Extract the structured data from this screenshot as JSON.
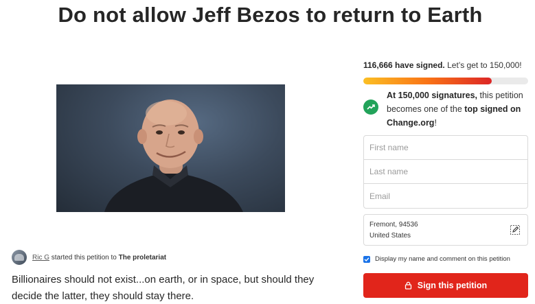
{
  "petition": {
    "title": "Do not allow Jeff Bezos to return to Earth",
    "starter_name": "Ric G",
    "starter_mid": "started this petition to",
    "target": "The proletariat",
    "description": "Billionaires should not exist...on earth, or in space, but should they decide the latter, they should stay there."
  },
  "sidebar": {
    "signed_count": "116,666 have signed.",
    "signed_goal": "Let’s get to 150,000!",
    "progress": 0.78,
    "goal_strong1": "At 150,000 signatures,",
    "goal_mid": "this petition becomes one of the",
    "goal_strong2": "top signed on Change.org",
    "goal_end": "!",
    "first_name_placeholder": "First name",
    "last_name_placeholder": "Last name",
    "email_placeholder": "Email",
    "location_line1": "Fremont, 94536",
    "location_line2": "United States",
    "consent_label": "Display my name and comment on this petition",
    "sign_label": "Sign this petition"
  },
  "icons": {
    "goal": "trending-up-icon",
    "edit": "edit-location-icon",
    "lock": "lock-icon"
  },
  "colors": {
    "sign_button": "#e1251b",
    "goal_icon": "#22a35a",
    "checkbox": "#1a73e8"
  }
}
